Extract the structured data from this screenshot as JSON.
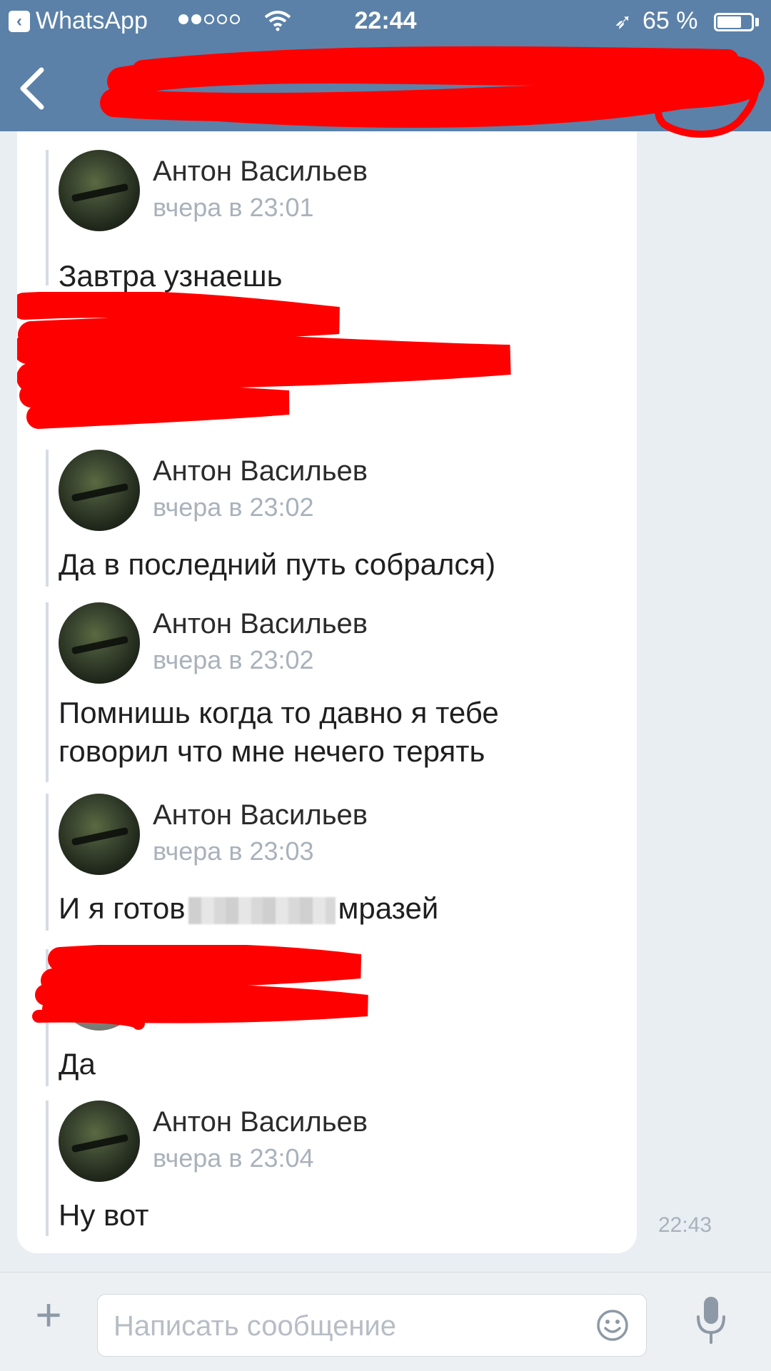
{
  "status_bar": {
    "back_app": "WhatsApp",
    "time": "22:44",
    "battery": "65 %",
    "battery_level": 0.65
  },
  "nav": {
    "title": ""
  },
  "messages": [
    {
      "sender": "Антон Васильев",
      "time": "вчера в 23:01",
      "lines": [
        "Завтра узнаешь"
      ]
    },
    {
      "sender": "Антон Васильев",
      "time": "вчера в 23:02",
      "lines": [
        "Да в последний путь собрался)"
      ]
    },
    {
      "sender": "Антон Васильев",
      "time": "вчера в 23:02",
      "lines": [
        "Помнишь когда то давно я тебе",
        "говорил что мне нечего терять"
      ]
    },
    {
      "sender": "Антон Васильев",
      "time": "вчера в 23:03",
      "text_before": "И я готов",
      "text_after": "мразей"
    },
    {
      "lines": [
        "Да"
      ]
    },
    {
      "sender": "Антон Васильев",
      "time": "вчера в 23:04",
      "lines": [
        "Ну вот"
      ]
    }
  ],
  "last_timestamp": "22:43",
  "composer": {
    "placeholder": "Написать сообщение"
  },
  "icons": [
    "back-icon",
    "wifi-icon",
    "location-icon",
    "battery-icon",
    "plus-icon",
    "emoji-icon",
    "microphone-icon"
  ],
  "colors": {
    "header": "#5b81a8",
    "background": "#e9eef3",
    "bubble": "#ffffff",
    "muted": "#a9b2bb",
    "redaction": "#ff0000"
  }
}
